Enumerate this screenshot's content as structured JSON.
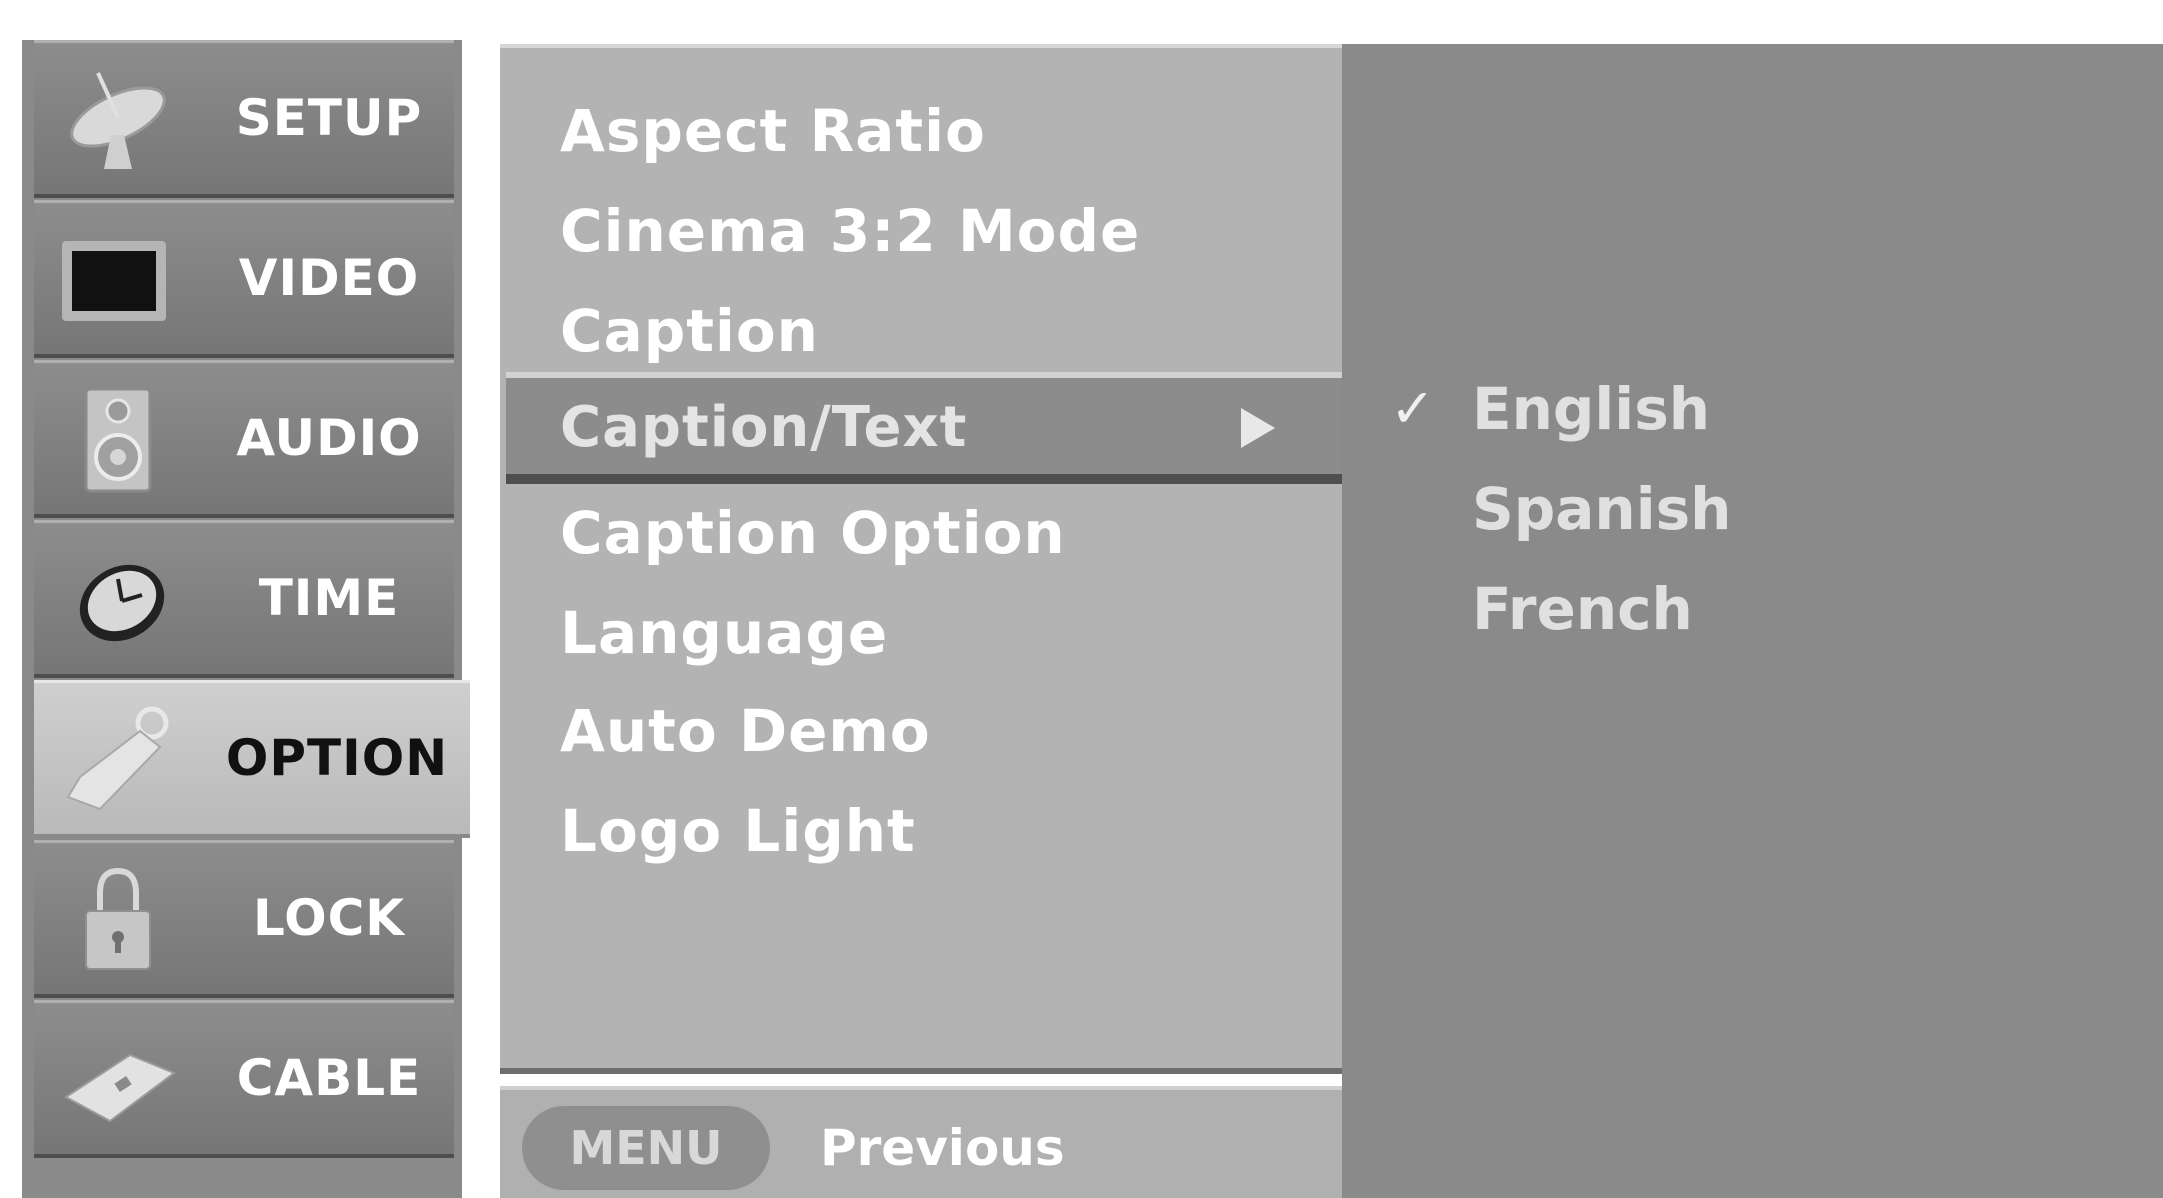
{
  "tabs": [
    {
      "label": "SETUP",
      "icon": "satellite-dish-icon"
    },
    {
      "label": "VIDEO",
      "icon": "screen-icon"
    },
    {
      "label": "AUDIO",
      "icon": "speaker-icon"
    },
    {
      "label": "TIME",
      "icon": "clock-icon"
    },
    {
      "label": "OPTION",
      "icon": "tag-icon",
      "active": true
    },
    {
      "label": "LOCK",
      "icon": "padlock-icon"
    },
    {
      "label": "CABLE",
      "icon": "cable-card-icon"
    }
  ],
  "submenu": {
    "items": [
      "Aspect Ratio",
      "Cinema 3:2 Mode",
      "Caption",
      "Caption/Text",
      "Caption Option",
      "Language",
      "Auto Demo",
      "Logo Light"
    ],
    "selected": "Caption/Text"
  },
  "options": {
    "items": [
      "English",
      "Spanish",
      "French"
    ],
    "checked": "English"
  },
  "footer": {
    "key": "MENU",
    "text": "Previous"
  }
}
